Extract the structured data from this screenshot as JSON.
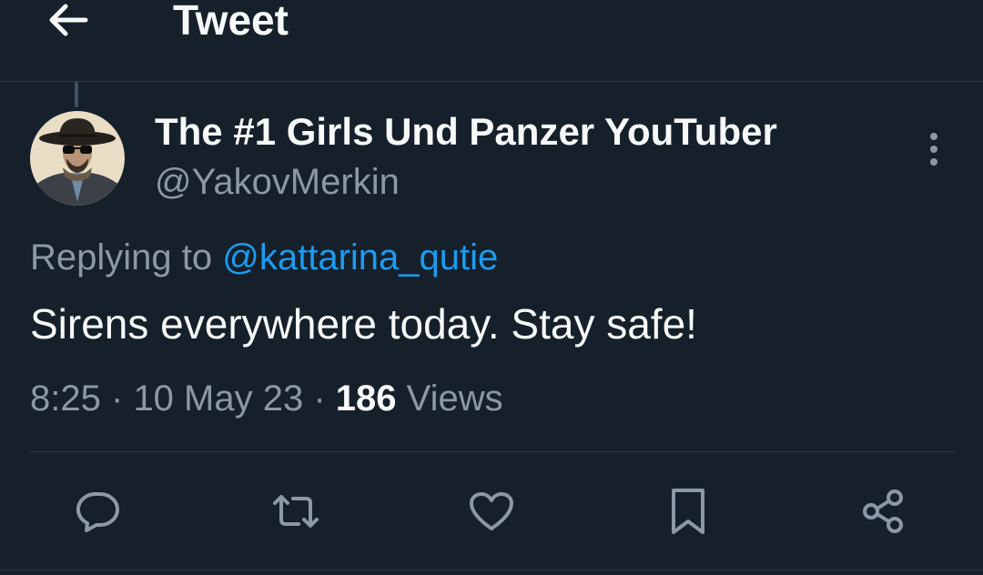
{
  "header": {
    "title": "Tweet",
    "back_icon": "arrow-left-icon"
  },
  "tweet": {
    "author": {
      "display_name": "The #1 Girls Und Panzer YouTuber",
      "handle": "@YakovMerkin",
      "avatar": "avatar-cowboy-hat-sunglasses"
    },
    "replying_to": {
      "prefix": "Replying to",
      "handle": "@kattarina_qutie"
    },
    "text": "Sirens everywhere today. Stay safe!",
    "meta": {
      "time": "8:25",
      "separator": "·",
      "date": "10 May 23",
      "views_count": "186",
      "views_label": "Views"
    }
  },
  "actions": [
    {
      "name": "reply",
      "icon": "comment-icon"
    },
    {
      "name": "retweet",
      "icon": "retweet-icon"
    },
    {
      "name": "like",
      "icon": "heart-icon"
    },
    {
      "name": "bookmark",
      "icon": "bookmark-icon"
    },
    {
      "name": "share",
      "icon": "share-icon"
    }
  ],
  "colors": {
    "background": "#15202b",
    "text_primary": "#f7f9f9",
    "text_secondary": "#8b98a5",
    "accent": "#1d9bf0",
    "divider": "#2f3a45"
  }
}
